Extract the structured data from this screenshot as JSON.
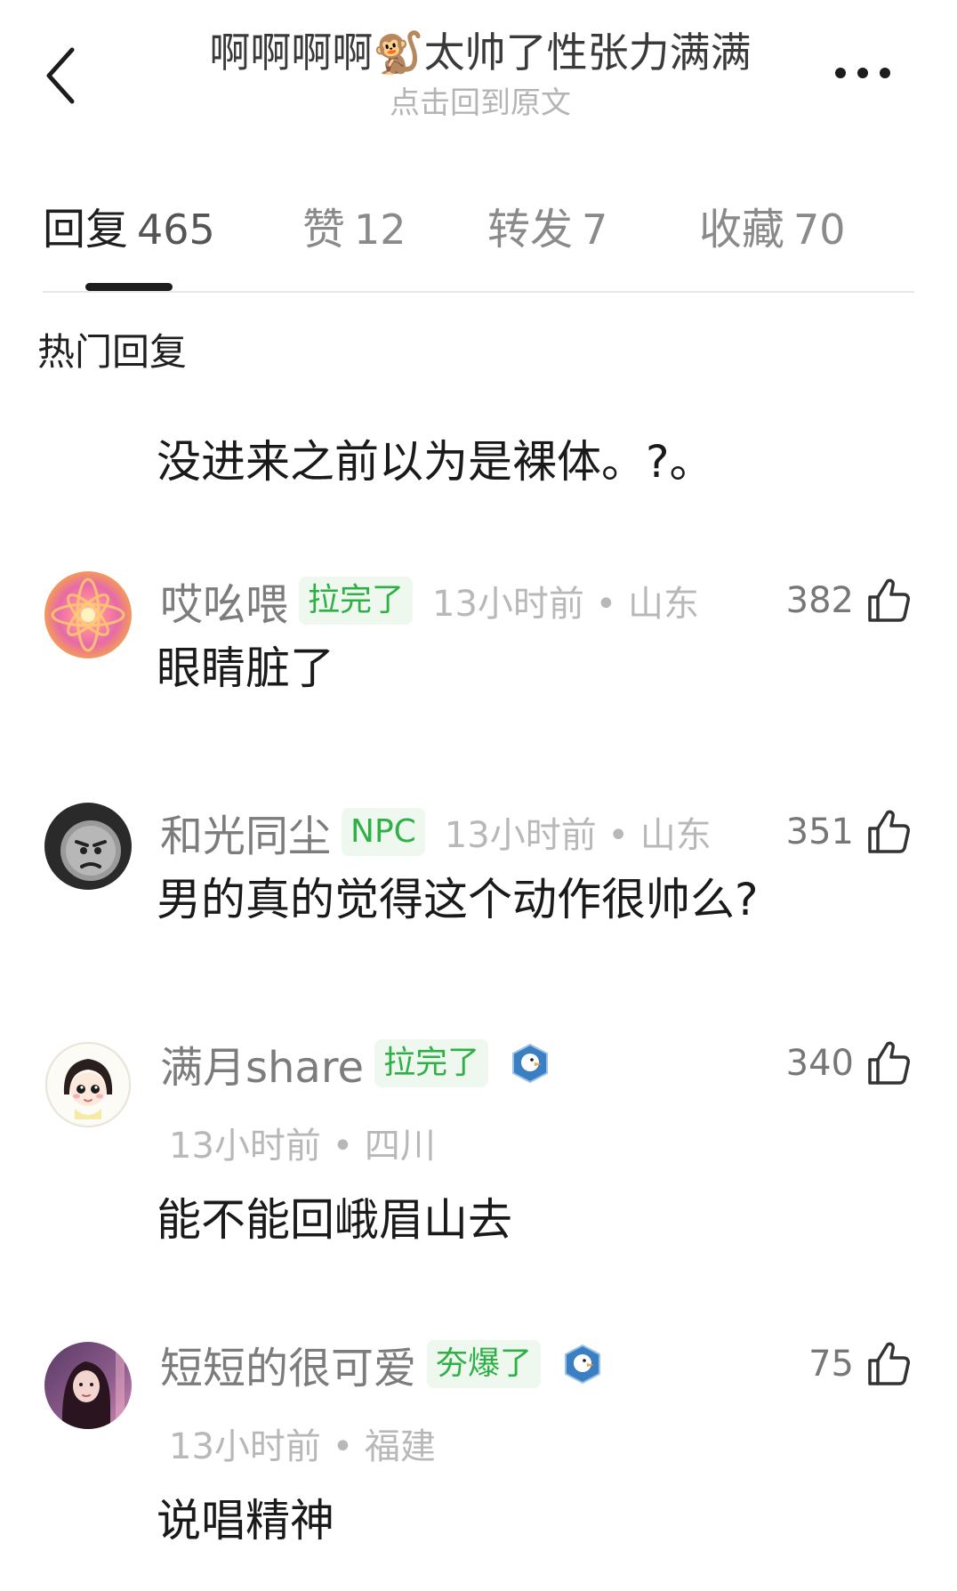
{
  "header": {
    "title": "啊啊啊啊🐒太帅了性张力满满",
    "subtitle": "点击回到原文"
  },
  "tabs": [
    {
      "label": "回复",
      "count": "465"
    },
    {
      "label": "赞",
      "count": "12"
    },
    {
      "label": "转发",
      "count": "7"
    },
    {
      "label": "收藏",
      "count": "70"
    }
  ],
  "section_title": "热门回复",
  "top_comment_text": "没进来之前以为是裸体。?。",
  "comments": [
    {
      "username": "哎吆喂",
      "tag": "拉完了",
      "time_location": "13小时前 • 山东",
      "likes": "382",
      "text": "眼睛脏了"
    },
    {
      "username": "和光同尘",
      "tag": "NPC",
      "time_location": "13小时前 • 山东",
      "likes": "351",
      "text": "男的真的觉得这个动作很帅么?"
    },
    {
      "username": "满月share",
      "tag": "拉完了",
      "time_location": "13小时前 • 四川",
      "likes": "340",
      "text": "能不能回峨眉山去"
    },
    {
      "username": "短短的很可爱",
      "tag": "夯爆了",
      "time_location": "13小时前 • 福建",
      "likes": "75",
      "text": "说唱精神"
    }
  ],
  "colors": {
    "tag_green": "#2fb047",
    "tag_bg": "#eef8ef",
    "muted": "#b8b8b8",
    "username": "#7c7c7c"
  },
  "icons": {
    "back": "chevron-left-icon",
    "more": "more-dots-icon",
    "like": "thumbs-up-icon",
    "badge": "duck-badge-icon"
  }
}
